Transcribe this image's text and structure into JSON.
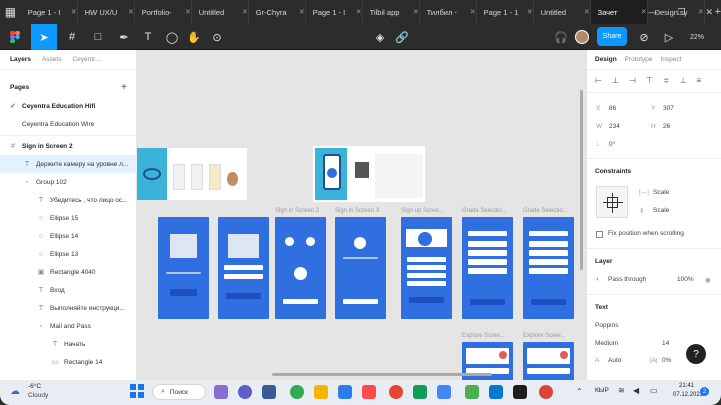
{
  "browser": {
    "tabs": [
      {
        "label": "Page 1 - I",
        "active": false
      },
      {
        "label": "HW UX/U",
        "active": false
      },
      {
        "label": "Portfolio-",
        "active": false
      },
      {
        "label": "Untitled",
        "active": false
      },
      {
        "label": "Gr-Chyra",
        "active": false
      },
      {
        "label": "Page 1 - I",
        "active": false
      },
      {
        "label": "Tilbil app",
        "active": false
      },
      {
        "label": "Тилбил -",
        "active": false
      },
      {
        "label": "Page 1 - 1",
        "active": false
      },
      {
        "label": "Untitled",
        "active": false
      },
      {
        "label": "Зачет",
        "active": true
      },
      {
        "label": "Design sy",
        "active": false
      }
    ]
  },
  "toolbar": {
    "share_label": "Share",
    "zoom": "22%"
  },
  "left_panel": {
    "tabs": [
      "Layers",
      "Assets"
    ],
    "page_selector": "Ceyentr...",
    "pages_header": "Pages",
    "pages": [
      {
        "label": "Ceyentra Education Hifi",
        "current": true
      },
      {
        "label": "Ceyentra Education Wire",
        "current": false
      }
    ],
    "frame": "Sign in Screen 2",
    "layers": [
      {
        "label": "Держите камеру на уровне л...",
        "icon": "text",
        "selected": true
      },
      {
        "label": "Group 102",
        "icon": "group",
        "selected": false
      },
      {
        "label": "Убедитесь , что лицо ос...",
        "icon": "text",
        "selected": false
      },
      {
        "label": "Ellipse 15",
        "icon": "ellipse",
        "selected": false
      },
      {
        "label": "Ellipse 14",
        "icon": "ellipse",
        "selected": false
      },
      {
        "label": "Ellipse 13",
        "icon": "ellipse",
        "selected": false
      },
      {
        "label": "Rectangle 4040",
        "icon": "image",
        "selected": false
      },
      {
        "label": "Вход",
        "icon": "text",
        "selected": false
      },
      {
        "label": "Выполняйте инструкци...",
        "icon": "text",
        "selected": false
      },
      {
        "label": "Mail and Pass",
        "icon": "group",
        "selected": false
      },
      {
        "label": "Начать",
        "icon": "text",
        "selected": false
      },
      {
        "label": "Rectangle 14",
        "icon": "rect",
        "selected": false
      }
    ]
  },
  "canvas": {
    "frame_labels": [
      "Sign in Screen 2",
      "Sign in Screen 3",
      "Sign up Scree...",
      "Grade Selectio...",
      "Grade Selectio...",
      "Explore Scree...",
      "Explore Scree..."
    ]
  },
  "right_panel": {
    "tabs": [
      "Design",
      "Prototype",
      "Inspect"
    ],
    "x_label": "X",
    "x_value": "86",
    "y_label": "Y",
    "y_value": "307",
    "w_label": "W",
    "w_value": "234",
    "h_label": "H",
    "h_value": "26",
    "rotation": "0°",
    "constraints_title": "Constraints",
    "constraint_h": "Scale",
    "constraint_v": "Scale",
    "fix_position": "Fix position when scrolling",
    "layer_title": "Layer",
    "blend": "Pass through",
    "opacity": "100%",
    "text_title": "Text",
    "font_family": "Poppins",
    "font_weight": "Medium",
    "font_size": "14",
    "line_height": "Auto",
    "letter_spacing": "0%"
  },
  "taskbar": {
    "weather_temp": "-6°C",
    "weather_desc": "Cloudy",
    "search_label": "Поиск",
    "language": "КЫР",
    "time": "21:41",
    "date": "07.12.2022"
  },
  "colors": {
    "accent": "#0d99ff",
    "phone_blue": "#2f6fe0",
    "canvas_bg": "#e5e5e5",
    "chrome_dark": "#2c2c2c"
  }
}
